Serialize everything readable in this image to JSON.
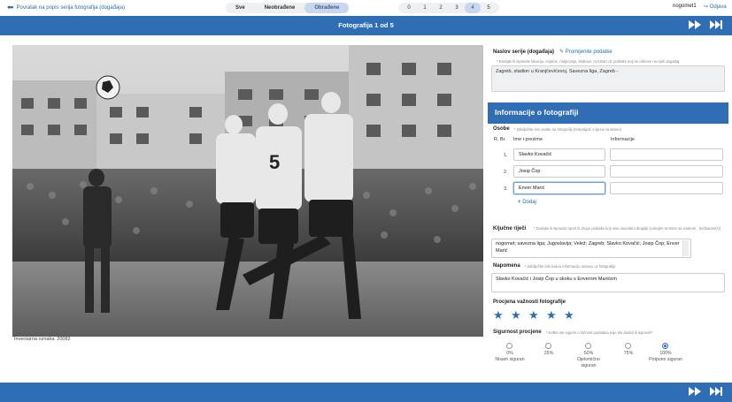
{
  "nav": {
    "back_label": "Povratak na popis serija fotografija (događaja)",
    "filters": [
      {
        "label": "Sve",
        "active": false
      },
      {
        "label": "Neobrađene",
        "active": false
      },
      {
        "label": "Obrađene",
        "active": true
      }
    ],
    "pages": [
      {
        "label": "0",
        "active": false
      },
      {
        "label": "1",
        "active": false
      },
      {
        "label": "2",
        "active": false
      },
      {
        "label": "3",
        "active": false
      },
      {
        "label": "4",
        "active": true
      },
      {
        "label": "5",
        "active": false
      }
    ],
    "username": "nogomet1",
    "logout_label": "Odjava"
  },
  "header": {
    "title": "Fotografija 1 od 5"
  },
  "photo": {
    "inventory_label": "Inventarna oznaka: 20082"
  },
  "series": {
    "label": "Naslov serije (događaja)",
    "edit_link": "Promijenite podatke",
    "hint": "* Dodajte ili ispravite lokaciju, vrijeme, natjecanje, klubove, rezultat i dr. podatke koji se odnose na cijeli događaj",
    "value": "Zagreb,   stadion u Kranjčevićevoj, Savezna liga,   Zagreb -"
  },
  "info": {
    "title": "Informacije o fotografiji",
    "persons_label": "Osobe",
    "persons_hint": "* Zabilježite sve osobe na fotografiji (redoslijed: s lijeva na desno)",
    "col_rb": "R. Br.",
    "col_name": "Ime i prezime",
    "col_info": "Informacije",
    "persons": [
      {
        "num": "1.",
        "name": "Slavko Kovačić",
        "info": ""
      },
      {
        "num": "2.",
        "name": "Josip Čop",
        "info": ""
      },
      {
        "num": "3.",
        "name": "Enver Marić",
        "info": ""
      }
    ],
    "add_label": "Dodaj",
    "keywords_label": "Ključne riječi",
    "keywords_hint": "* Dodajte ili ispravite sport ili druge podatke koji nisu navedeni drugdje (odvojite termine sa znakom ; (točkacarez))",
    "keywords_value": "nogomet; savezna liga; Jugoslavija; Velež; Zagreb; Slavko Kovačić; Josip Čop; Enver Marić",
    "note_label": "Napomena",
    "note_hint": "* Zabilježite bilo kakvu informaciju vezanu uz fotografiju",
    "note_value": "Slavko Kovačić i Josip Čop u skoku s Enverom Marićem",
    "importance_label": "Procjena važnosti fotografije",
    "importance_stars": 5,
    "certainty_label": "Sigurnost procjene",
    "certainty_hint": "* Koliko ste sigurni u točnost podataka koje ste dodali ili ispravili?",
    "certainty_options": [
      {
        "pct": "0%",
        "desc": "Nisam siguran"
      },
      {
        "pct": "25%",
        "desc": ""
      },
      {
        "pct": "50%",
        "desc": "Djelomično siguran"
      },
      {
        "pct": "75%",
        "desc": ""
      },
      {
        "pct": "100%",
        "desc": "Potpuno siguran"
      }
    ],
    "certainty_selected": 4
  },
  "colors": {
    "brand": "#2f6db5",
    "link": "#2a6ea8"
  }
}
